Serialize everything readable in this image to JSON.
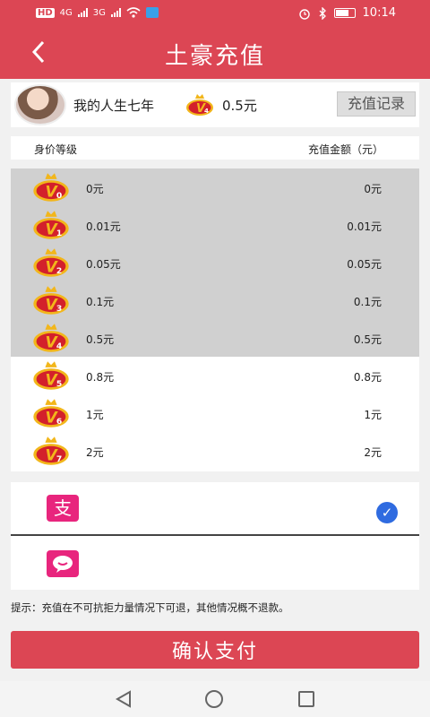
{
  "status_bar": {
    "network_left": "HD",
    "net1": "4G",
    "net2": "3G",
    "time": "10:14",
    "icons": [
      "signal-icon",
      "wifi-icon",
      "alarm-icon",
      "bluetooth-icon",
      "battery-icon"
    ]
  },
  "header": {
    "back_icon": "‹",
    "title": "土豪充值"
  },
  "user": {
    "name": "我的人生七年",
    "badge_level": "4",
    "balance": "0.5元",
    "recharge_record_label": "充值记录"
  },
  "table": {
    "col_level": "身价等级",
    "col_amount": "充值金额（元）"
  },
  "levels": [
    {
      "level": "0",
      "name": "0元",
      "amount": "0元",
      "selected": true
    },
    {
      "level": "1",
      "name": "0.01元",
      "amount": "0.01元",
      "selected": true
    },
    {
      "level": "2",
      "name": "0.05元",
      "amount": "0.05元",
      "selected": true
    },
    {
      "level": "3",
      "name": "0.1元",
      "amount": "0.1元",
      "selected": true
    },
    {
      "level": "4",
      "name": "0.5元",
      "amount": "0.5元",
      "selected": true
    },
    {
      "level": "5",
      "name": "0.8元",
      "amount": "0.8元",
      "selected": false
    },
    {
      "level": "6",
      "name": "1元",
      "amount": "1元",
      "selected": false
    },
    {
      "level": "7",
      "name": "2元",
      "amount": "2元",
      "selected": false
    }
  ],
  "payment": {
    "options": [
      {
        "icon": "alipay-icon",
        "glyph": "支",
        "checked": true
      },
      {
        "icon": "chat-pay-icon",
        "glyph": "",
        "checked": false
      }
    ]
  },
  "tip": "提示：充值在不可抗拒力量情况下可退，其他情况概不退款。",
  "confirm_label": "确认支付",
  "colors": {
    "brand": "#dc4654",
    "badge_red": "#d3202b",
    "badge_gold": "#f2b61b",
    "pay_pink": "#e8257d",
    "check_blue": "#2f6be0"
  }
}
